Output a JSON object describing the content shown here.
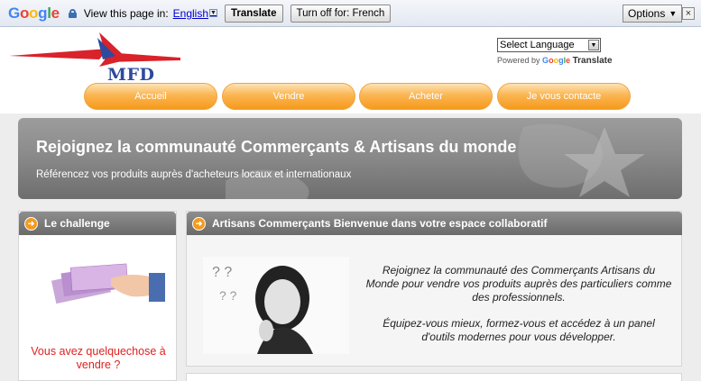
{
  "translate_bar": {
    "logo_text": "Google",
    "view_text": "View this page in:",
    "language_link": "English",
    "translate_button": "Translate",
    "turn_off_button": "Turn off for: French",
    "options_label": "Options",
    "close_label": "×"
  },
  "header": {
    "logo_text": "MFD",
    "language_select": "Select Language",
    "powered_by": "Powered by",
    "google_word": "Google",
    "translate_word": "Translate"
  },
  "nav": {
    "items": [
      {
        "label": "Accueil"
      },
      {
        "label": "Vendre"
      },
      {
        "label": "Acheter"
      },
      {
        "label": "Je vous contacte"
      }
    ]
  },
  "hero": {
    "title": "Rejoignez la communauté  Commerçants & Artisans du monde",
    "subtitle": "Référencez vos produits auprès d'acheteurs locaux et internationaux"
  },
  "left_panel": {
    "title": "Le challenge",
    "text": "Vous avez quelquechose à vendre ?"
  },
  "right_panel": {
    "title": "Artisans Commerçants Bienvenue dans votre espace collaboratif",
    "paragraph1": "Rejoignez la communauté des Commerçants Artisans du Monde pour vendre vos produits auprès des particuliers comme des professionnels.",
    "paragraph2": "Équipez-vous mieux, formez-vous et accédez à un panel d'outils modernes pour vous développer."
  },
  "colors": {
    "accent_orange": "#f59a1b",
    "logo_red": "#d9222a",
    "logo_blue": "#2e4a9e",
    "link_blue": "#0000cc",
    "alert_red": "#e02020"
  }
}
